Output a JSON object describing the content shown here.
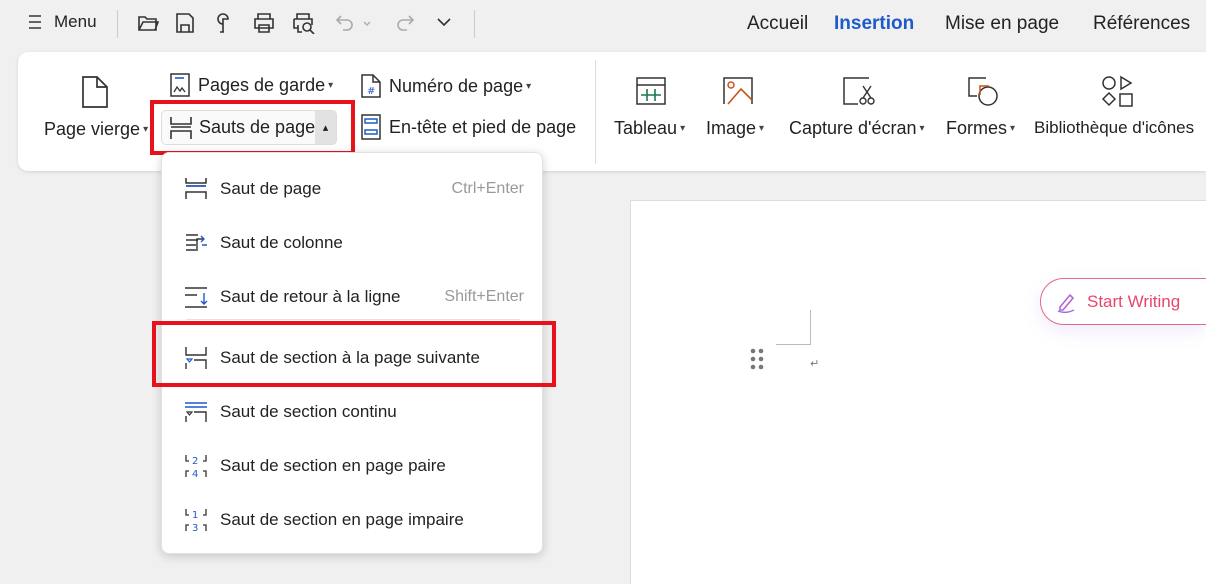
{
  "quickbar": {
    "menu_label": "Menu"
  },
  "tabs": [
    {
      "label": "Accueil"
    },
    {
      "label": "Insertion"
    },
    {
      "label": "Mise en page"
    },
    {
      "label": "Références"
    }
  ],
  "ribbon": {
    "page_vierge": "Page vierge",
    "pages_de_garde": "Pages de garde",
    "sauts_de_page": "Sauts de page",
    "numero_de_page": "Numéro de page",
    "entete": "En-tête et pied de page",
    "tableau": "Tableau",
    "image": "Image",
    "capture": "Capture d'écran",
    "formes": "Formes",
    "bibliotheque": "Bibliothèque d'icônes"
  },
  "menu": {
    "items": [
      {
        "label": "Saut de page",
        "shortcut": "Ctrl+Enter"
      },
      {
        "label": "Saut de colonne",
        "shortcut": ""
      },
      {
        "label": "Saut de retour à la ligne",
        "shortcut": "Shift+Enter"
      },
      {
        "label": "Saut de section à la page suivante",
        "shortcut": ""
      },
      {
        "label": "Saut de section continu",
        "shortcut": ""
      },
      {
        "label": "Saut de section en page paire",
        "shortcut": ""
      },
      {
        "label": "Saut de section en page impaire",
        "shortcut": ""
      }
    ]
  },
  "document": {
    "start_writing": "Start Writing"
  },
  "colors": {
    "accent": "#1f5bc7",
    "highlight": "#e8121d",
    "ai": "#e8456b"
  }
}
